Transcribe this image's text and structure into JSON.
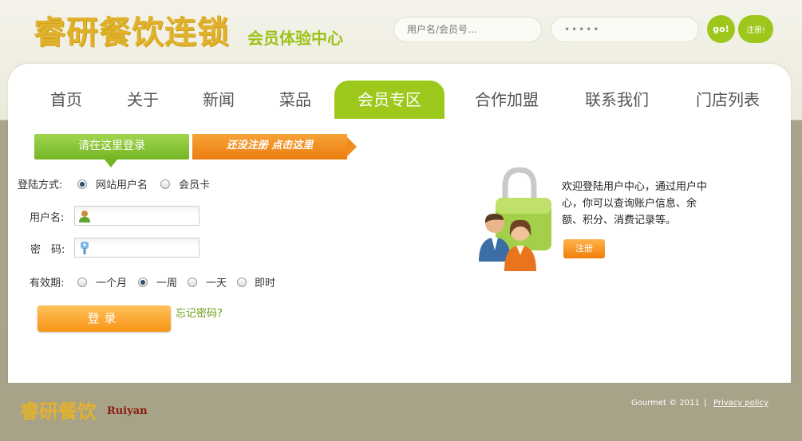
{
  "header": {
    "logo_main": "睿研餐饮连锁",
    "logo_sub": "会员体验中心",
    "username_placeholder": "用户名/会员号...",
    "password_value": "•••••",
    "go_label": "go!",
    "register_label": "注册!"
  },
  "nav": {
    "items": [
      {
        "label": "首页"
      },
      {
        "label": "关于"
      },
      {
        "label": "新闻"
      },
      {
        "label": "菜品"
      },
      {
        "label": "会员专区",
        "active": true
      },
      {
        "label": "合作加盟"
      },
      {
        "label": "联系我们"
      },
      {
        "label": "门店列表"
      }
    ]
  },
  "tabs": {
    "login_label": "请在这里登录",
    "register_label": "还没注册 点击这里"
  },
  "form": {
    "login_method_label": "登陆方式:",
    "method_options": [
      "网站用户名",
      "会员卡"
    ],
    "method_selected": "网站用户名",
    "username_label": "用户名:",
    "username_value": "",
    "password_label": "密　码:",
    "password_value": "",
    "validity_label": "有效期:",
    "validity_options": [
      "一个月",
      "一周",
      "一天",
      "即时"
    ],
    "validity_selected": "一周",
    "login_button": "登录",
    "forgot_link": "忘记密码?"
  },
  "side": {
    "welcome_text": "欢迎登陆用户中心，通过用户中心，你可以查询账户信息、余额、积分、消费记录等。",
    "register_button": "注册"
  },
  "footer": {
    "logo": "睿研餐饮",
    "brand": "Ruiyan",
    "copyright": "Gourmet  © 2011",
    "separator": "|",
    "privacy_link": "Privacy policy"
  },
  "colors": {
    "accent_green": "#9dc91c",
    "accent_orange": "#f08b1c",
    "logo_gold": "#e0b12b"
  }
}
